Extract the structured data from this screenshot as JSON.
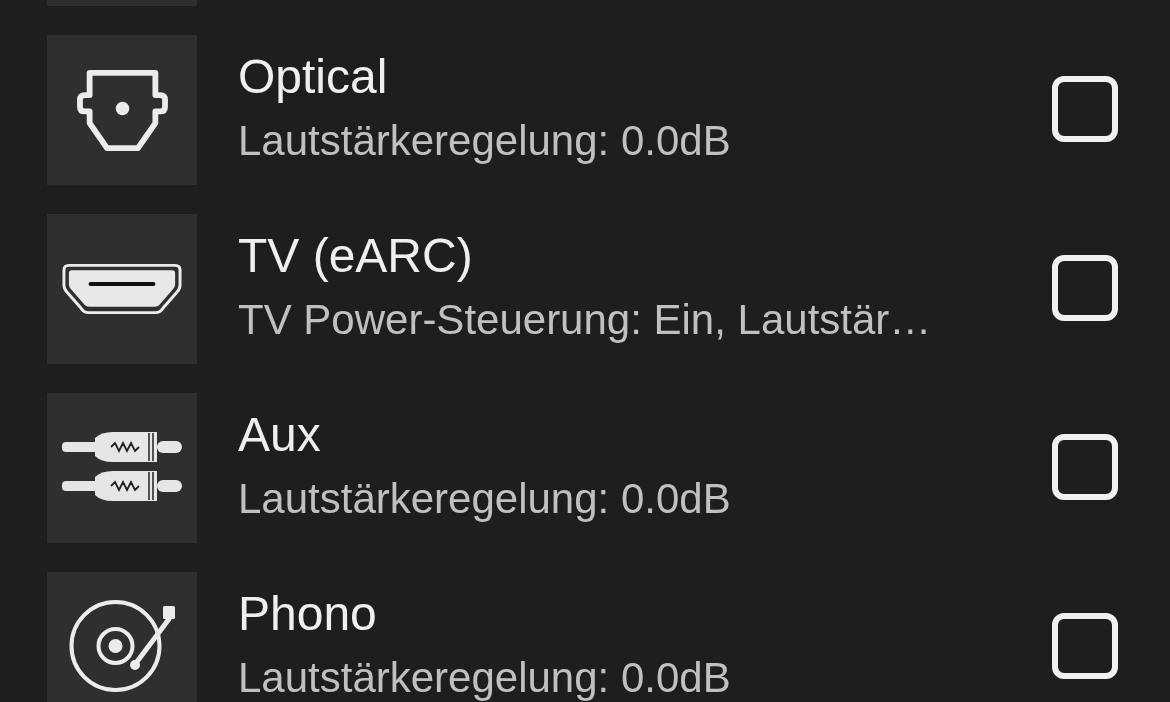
{
  "list": {
    "row_above_cut_off": true,
    "rows": [
      {
        "title": "Optical",
        "detail": "Lautstärkeregelung: 0.0dB",
        "checked": false
      },
      {
        "title": "TV (eARC)",
        "detail": "TV Power-Steuerung: Ein, Lautstär…",
        "checked": false
      },
      {
        "title": "Aux",
        "detail": "Lautstärkeregelung: 0.0dB",
        "checked": false
      },
      {
        "title": "Phono",
        "detail": "Lautstärkeregelung: 0.0dB",
        "checked": false
      }
    ]
  }
}
